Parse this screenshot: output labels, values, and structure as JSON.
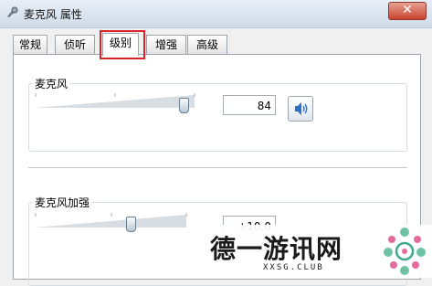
{
  "window": {
    "title": "麦克风 属性",
    "close_label": "✕"
  },
  "tabs": [
    {
      "label": "常规",
      "active": false
    },
    {
      "label": "侦听",
      "active": false
    },
    {
      "label": "级别",
      "active": true
    },
    {
      "label": "增强",
      "active": false
    },
    {
      "label": "高级",
      "active": false
    }
  ],
  "microphone": {
    "label": "麦克风",
    "value": "84",
    "level": 84
  },
  "boost": {
    "label": "麦克风加强",
    "value": "+10.0 dB"
  },
  "watermark": {
    "text": "德一游讯网",
    "url": "XXSG.CLUB"
  },
  "colors": {
    "highlight": "#d9252a",
    "speaker_blue": "#2f6fc4"
  },
  "icons": {
    "title": "microphone-icon",
    "speaker": "speaker-icon"
  }
}
